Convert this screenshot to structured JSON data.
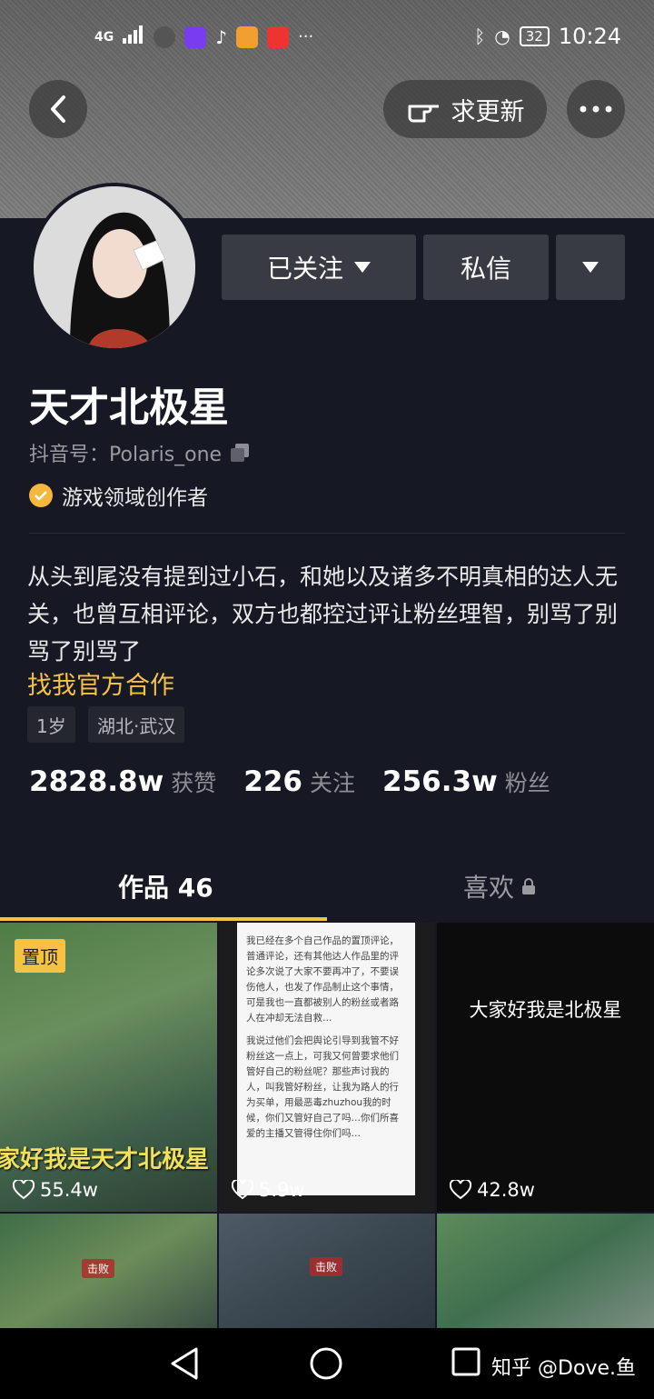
{
  "status_bar": {
    "network": "4G",
    "time": "10:24",
    "battery": "32"
  },
  "header": {
    "update_label": "求更新"
  },
  "profile": {
    "follow_label": "已关注",
    "message_label": "私信",
    "name": "天才北极星",
    "douyin_id": "抖音号：Polaris_one",
    "creator_badge": "游戏领域创作者",
    "bio": "从头到尾没有提到过小石，和她以及诸多不明真相的达人无关，也曾互相评论，双方也都控过评让粉丝理智，别骂了别骂了别骂了",
    "collab_link": "找我官方合作",
    "tags": [
      "1岁",
      "湖北·武汉"
    ],
    "stats": [
      {
        "value": "2828.8w",
        "label": "获赞"
      },
      {
        "value": "226",
        "label": "关注"
      },
      {
        "value": "256.3w",
        "label": "粉丝"
      }
    ]
  },
  "tabs": {
    "works": "作品 46",
    "likes": "喜欢"
  },
  "videos": [
    {
      "pinned_label": "置顶",
      "likes": "55.4w",
      "overlay": "家好我是天才北极星"
    },
    {
      "likes": "5.9w",
      "paragraph1": "我已经在多个自己作品的置顶评论，普通评论，还有其他达人作品里的评论多次说了大家不要再冲了，不要误伤他人，也发了作品制止这个事情，可是我也一直都被别人的粉丝或者路人在冲却无法自救…",
      "paragraph2": "我说过他们会把舆论引导到我管不好粉丝这一点上，可我又何曾要求他们管好自己的粉丝呢？那些声讨我的人，叫我管好粉丝，让我为路人的行为买单，用最恶毒zhuzhou我的时候，你们又管好自己了吗…你们所喜爱的主播又管得住你们吗…"
    },
    {
      "likes": "42.8w",
      "title": "大家好我是北极星"
    },
    {
      "hud": "击败"
    },
    {
      "hud": "击败"
    },
    {
      "hud": ""
    }
  ],
  "watermark": "知乎 @Dove.鱼"
}
